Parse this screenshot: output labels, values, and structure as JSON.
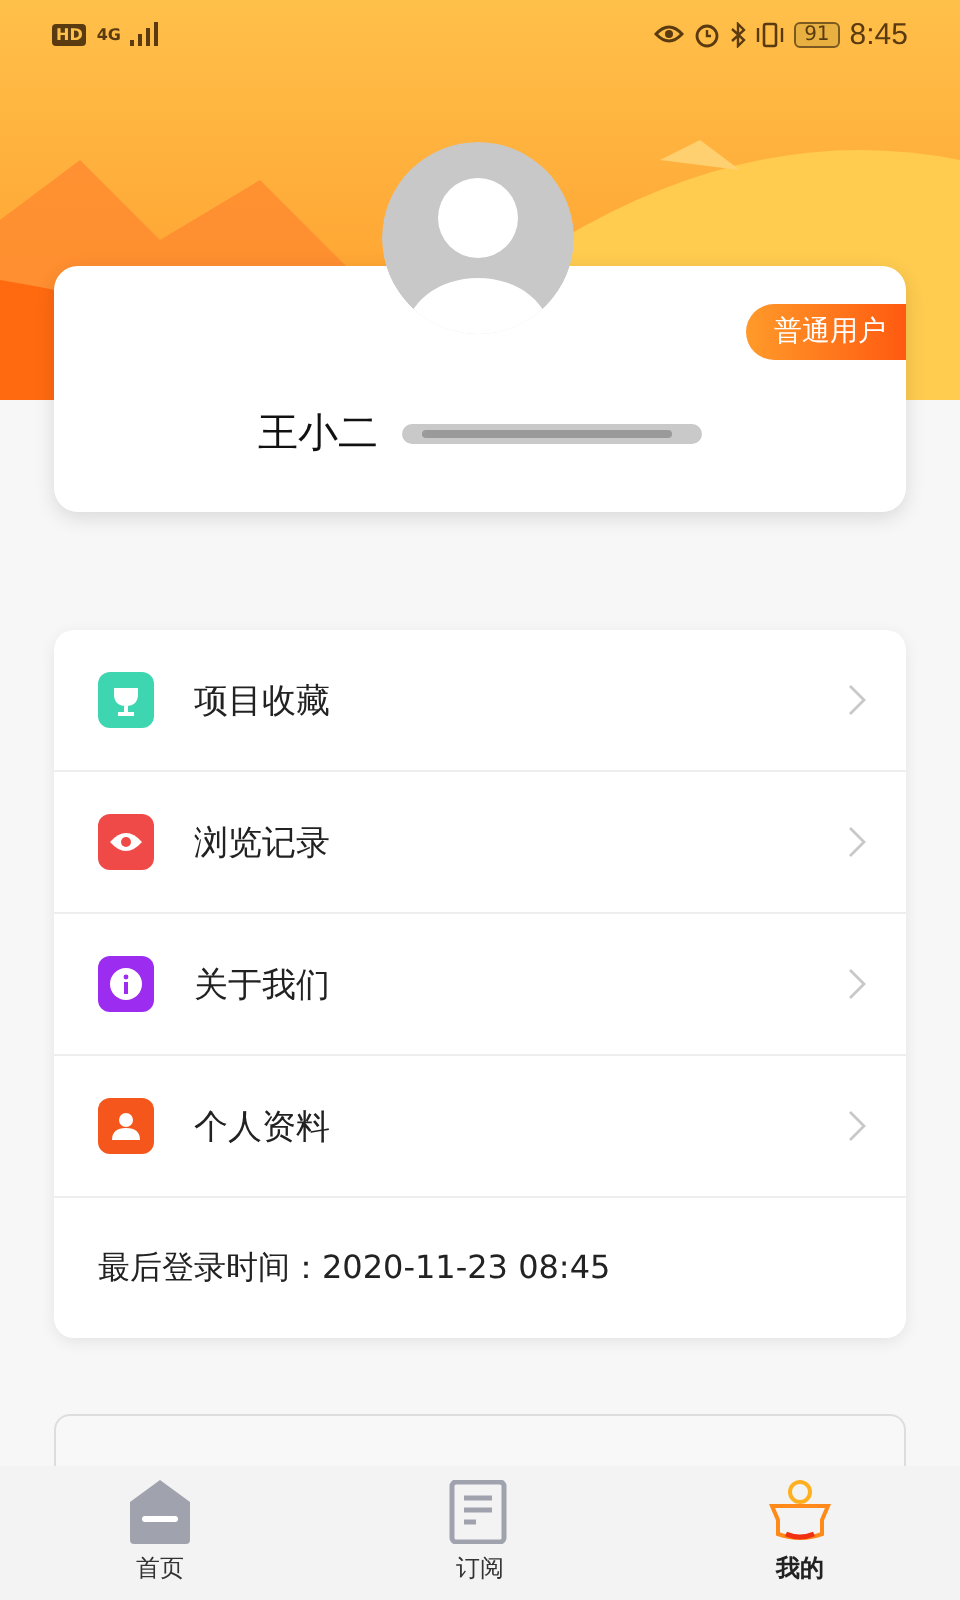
{
  "status_bar": {
    "hd": "HD",
    "network": "4G",
    "battery": "91",
    "time": "8:45"
  },
  "profile": {
    "name": "王小二",
    "badge": "普通用户"
  },
  "menu": [
    {
      "label": "项目收藏",
      "color": "#3ed6b0"
    },
    {
      "label": "浏览记录",
      "color": "#f04a48"
    },
    {
      "label": "关于我们",
      "color": "#9b2cf0"
    },
    {
      "label": "个人资料",
      "color": "#f4561c"
    }
  ],
  "last_login": "最后登录时间：2020-11-23 08:45",
  "tabs": [
    {
      "label": "首页",
      "selected": false
    },
    {
      "label": "订阅",
      "selected": false
    },
    {
      "label": "我的",
      "selected": true
    }
  ]
}
